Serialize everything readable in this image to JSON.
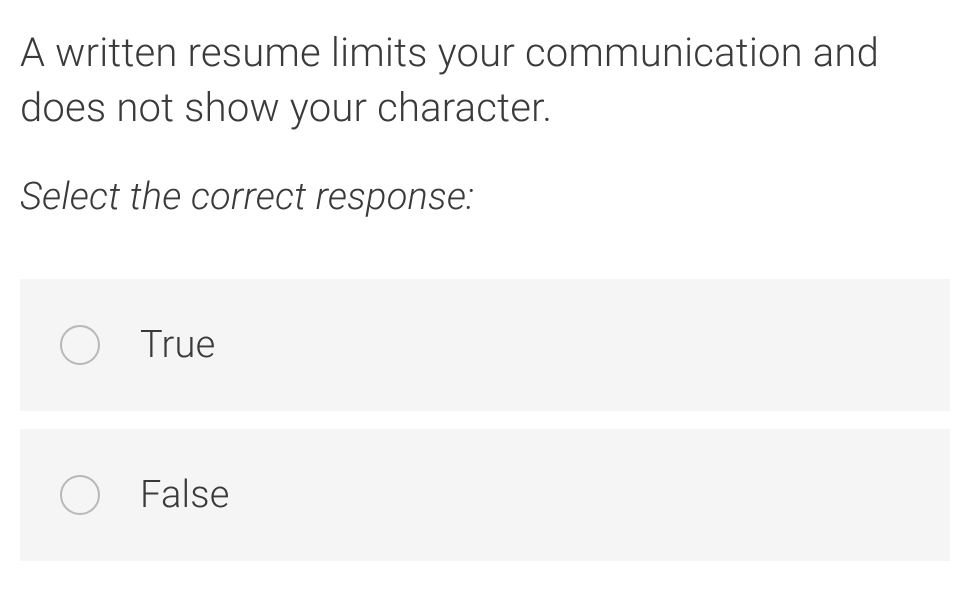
{
  "question": {
    "text": "A written resume limits your communication and does not show your character.",
    "instruction": "Select the correct response:",
    "options": [
      {
        "label": "True"
      },
      {
        "label": "False"
      }
    ]
  }
}
